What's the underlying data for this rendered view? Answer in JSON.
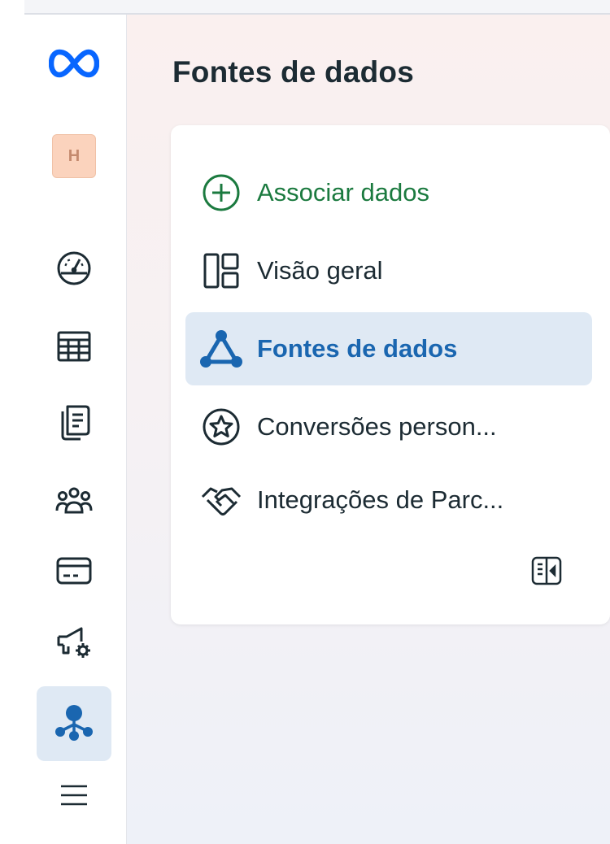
{
  "rail": {
    "logo_icon": "meta-logo-icon",
    "avatar_letter": "H",
    "items": [
      {
        "name": "dashboard",
        "icon": "gauge-icon"
      },
      {
        "name": "table",
        "icon": "table-icon"
      },
      {
        "name": "documents",
        "icon": "documents-icon"
      },
      {
        "name": "audiences",
        "icon": "people-icon"
      },
      {
        "name": "billing",
        "icon": "credit-card-icon"
      },
      {
        "name": "ads-settings",
        "icon": "megaphone-gear-icon"
      },
      {
        "name": "data-sources",
        "icon": "data-sources-icon",
        "active": true
      },
      {
        "name": "menu",
        "icon": "hamburger-menu-icon"
      }
    ]
  },
  "page": {
    "title": "Fontes de dados"
  },
  "nav": {
    "add_label": "Associar dados",
    "overview_label": "Visão geral",
    "data_sources_label": "Fontes de dados",
    "conversions_label": "Conversões person...",
    "integrations_label": "Integrações de Parc...",
    "collapse_icon": "collapse-panel-icon"
  },
  "colors": {
    "accent_blue": "#1a66b0",
    "active_bg": "#dfe9f4",
    "add_green": "#1b7a3f",
    "meta_blue": "#0866ff"
  }
}
